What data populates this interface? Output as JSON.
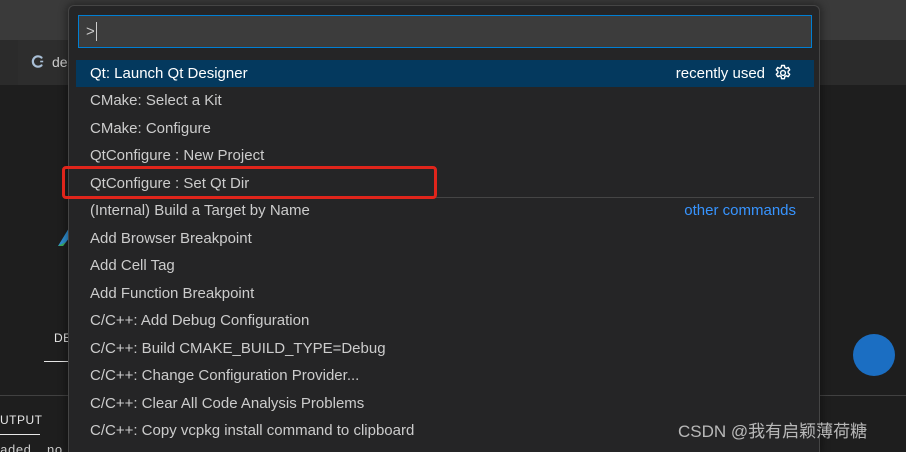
{
  "colors": {
    "focus_border": "#007fd4",
    "selected_row": "#04395e",
    "link": "#3794ff",
    "annotation": "#e0251b"
  },
  "icons": {
    "tab_file": "c-file-icon",
    "item_settings": "gear-icon"
  },
  "window": {
    "tab_label": "de",
    "panel_debug_tab": "DE",
    "panel_output_tab": "UTPUT",
    "output_text": "aded  no"
  },
  "palette": {
    "input_value": ">",
    "selected_index": 0,
    "items": [
      {
        "label": "Qt: Launch Qt Designer",
        "tag": "recently used"
      },
      {
        "label": "CMake: Select a Kit"
      },
      {
        "label": "CMake: Configure"
      },
      {
        "label": "QtConfigure : New Project"
      },
      {
        "label": "QtConfigure : Set Qt Dir"
      },
      {
        "label": "(Internal) Build a Target by Name",
        "tag": "other commands"
      },
      {
        "label": "Add Browser Breakpoint"
      },
      {
        "label": "Add Cell Tag"
      },
      {
        "label": "Add Function Breakpoint"
      },
      {
        "label": "C/C++: Add Debug Configuration"
      },
      {
        "label": "C/C++: Build CMAKE_BUILD_TYPE=Debug"
      },
      {
        "label": "C/C++: Change Configuration Provider..."
      },
      {
        "label": "C/C++: Clear All Code Analysis Problems"
      },
      {
        "label": "C/C++: Copy vcpkg install command to clipboard"
      }
    ]
  },
  "watermark": "CSDN @我有启颖薄荷糖"
}
